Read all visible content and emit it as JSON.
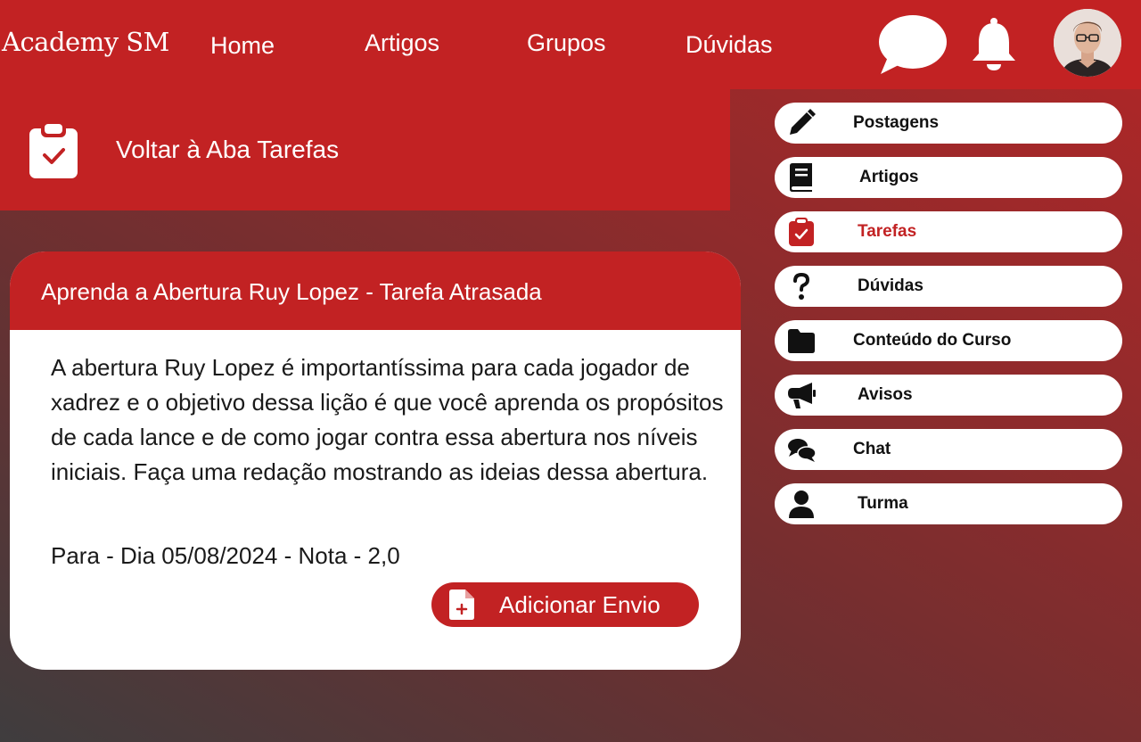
{
  "header": {
    "brand": "Academy SM",
    "nav": {
      "home": "Home",
      "artigos": "Artigos",
      "grupos": "Grupos",
      "duvidas": "Dúvidas"
    },
    "icons": [
      "chat-bubble-icon",
      "bell-icon"
    ],
    "avatar": "user-avatar"
  },
  "back_banner": {
    "icon": "clipboard-check-icon",
    "label": "Voltar à Aba Tarefas"
  },
  "side_menu": {
    "items": [
      {
        "label": "Postagens",
        "icon": "pencil-icon",
        "active": false
      },
      {
        "label": "Artigos",
        "icon": "book-icon",
        "active": false
      },
      {
        "label": "Tarefas",
        "icon": "clipboard-check-icon",
        "active": true
      },
      {
        "label": "Dúvidas",
        "icon": "question-icon",
        "active": false
      },
      {
        "label": "Conteúdo do Curso",
        "icon": "folder-icon",
        "active": false
      },
      {
        "label": "Avisos",
        "icon": "megaphone-icon",
        "active": false
      },
      {
        "label": "Chat",
        "icon": "comments-icon",
        "active": false
      },
      {
        "label": "Turma",
        "icon": "user-icon",
        "active": false
      }
    ]
  },
  "task": {
    "title": "Aprenda a Abertura Ruy Lopez - Tarefa Atrasada",
    "description": "A abertura Ruy Lopez é importantíssima para cada jogador de xadrez e o objetivo dessa lição é que você aprenda os propósitos de cada lance e de como jogar contra essa abertura nos níveis iniciais. Faça uma redação mostrando as ideias dessa abertura.",
    "due": "Para - Dia 05/08/2024 - Nota - 2,0",
    "submit_label": "Adicionar Envio",
    "submit_icon": "file-plus-icon"
  },
  "colors": {
    "primary": "#c22223",
    "card_bg": "#ffffff",
    "text_dark": "#1a1a1a"
  }
}
